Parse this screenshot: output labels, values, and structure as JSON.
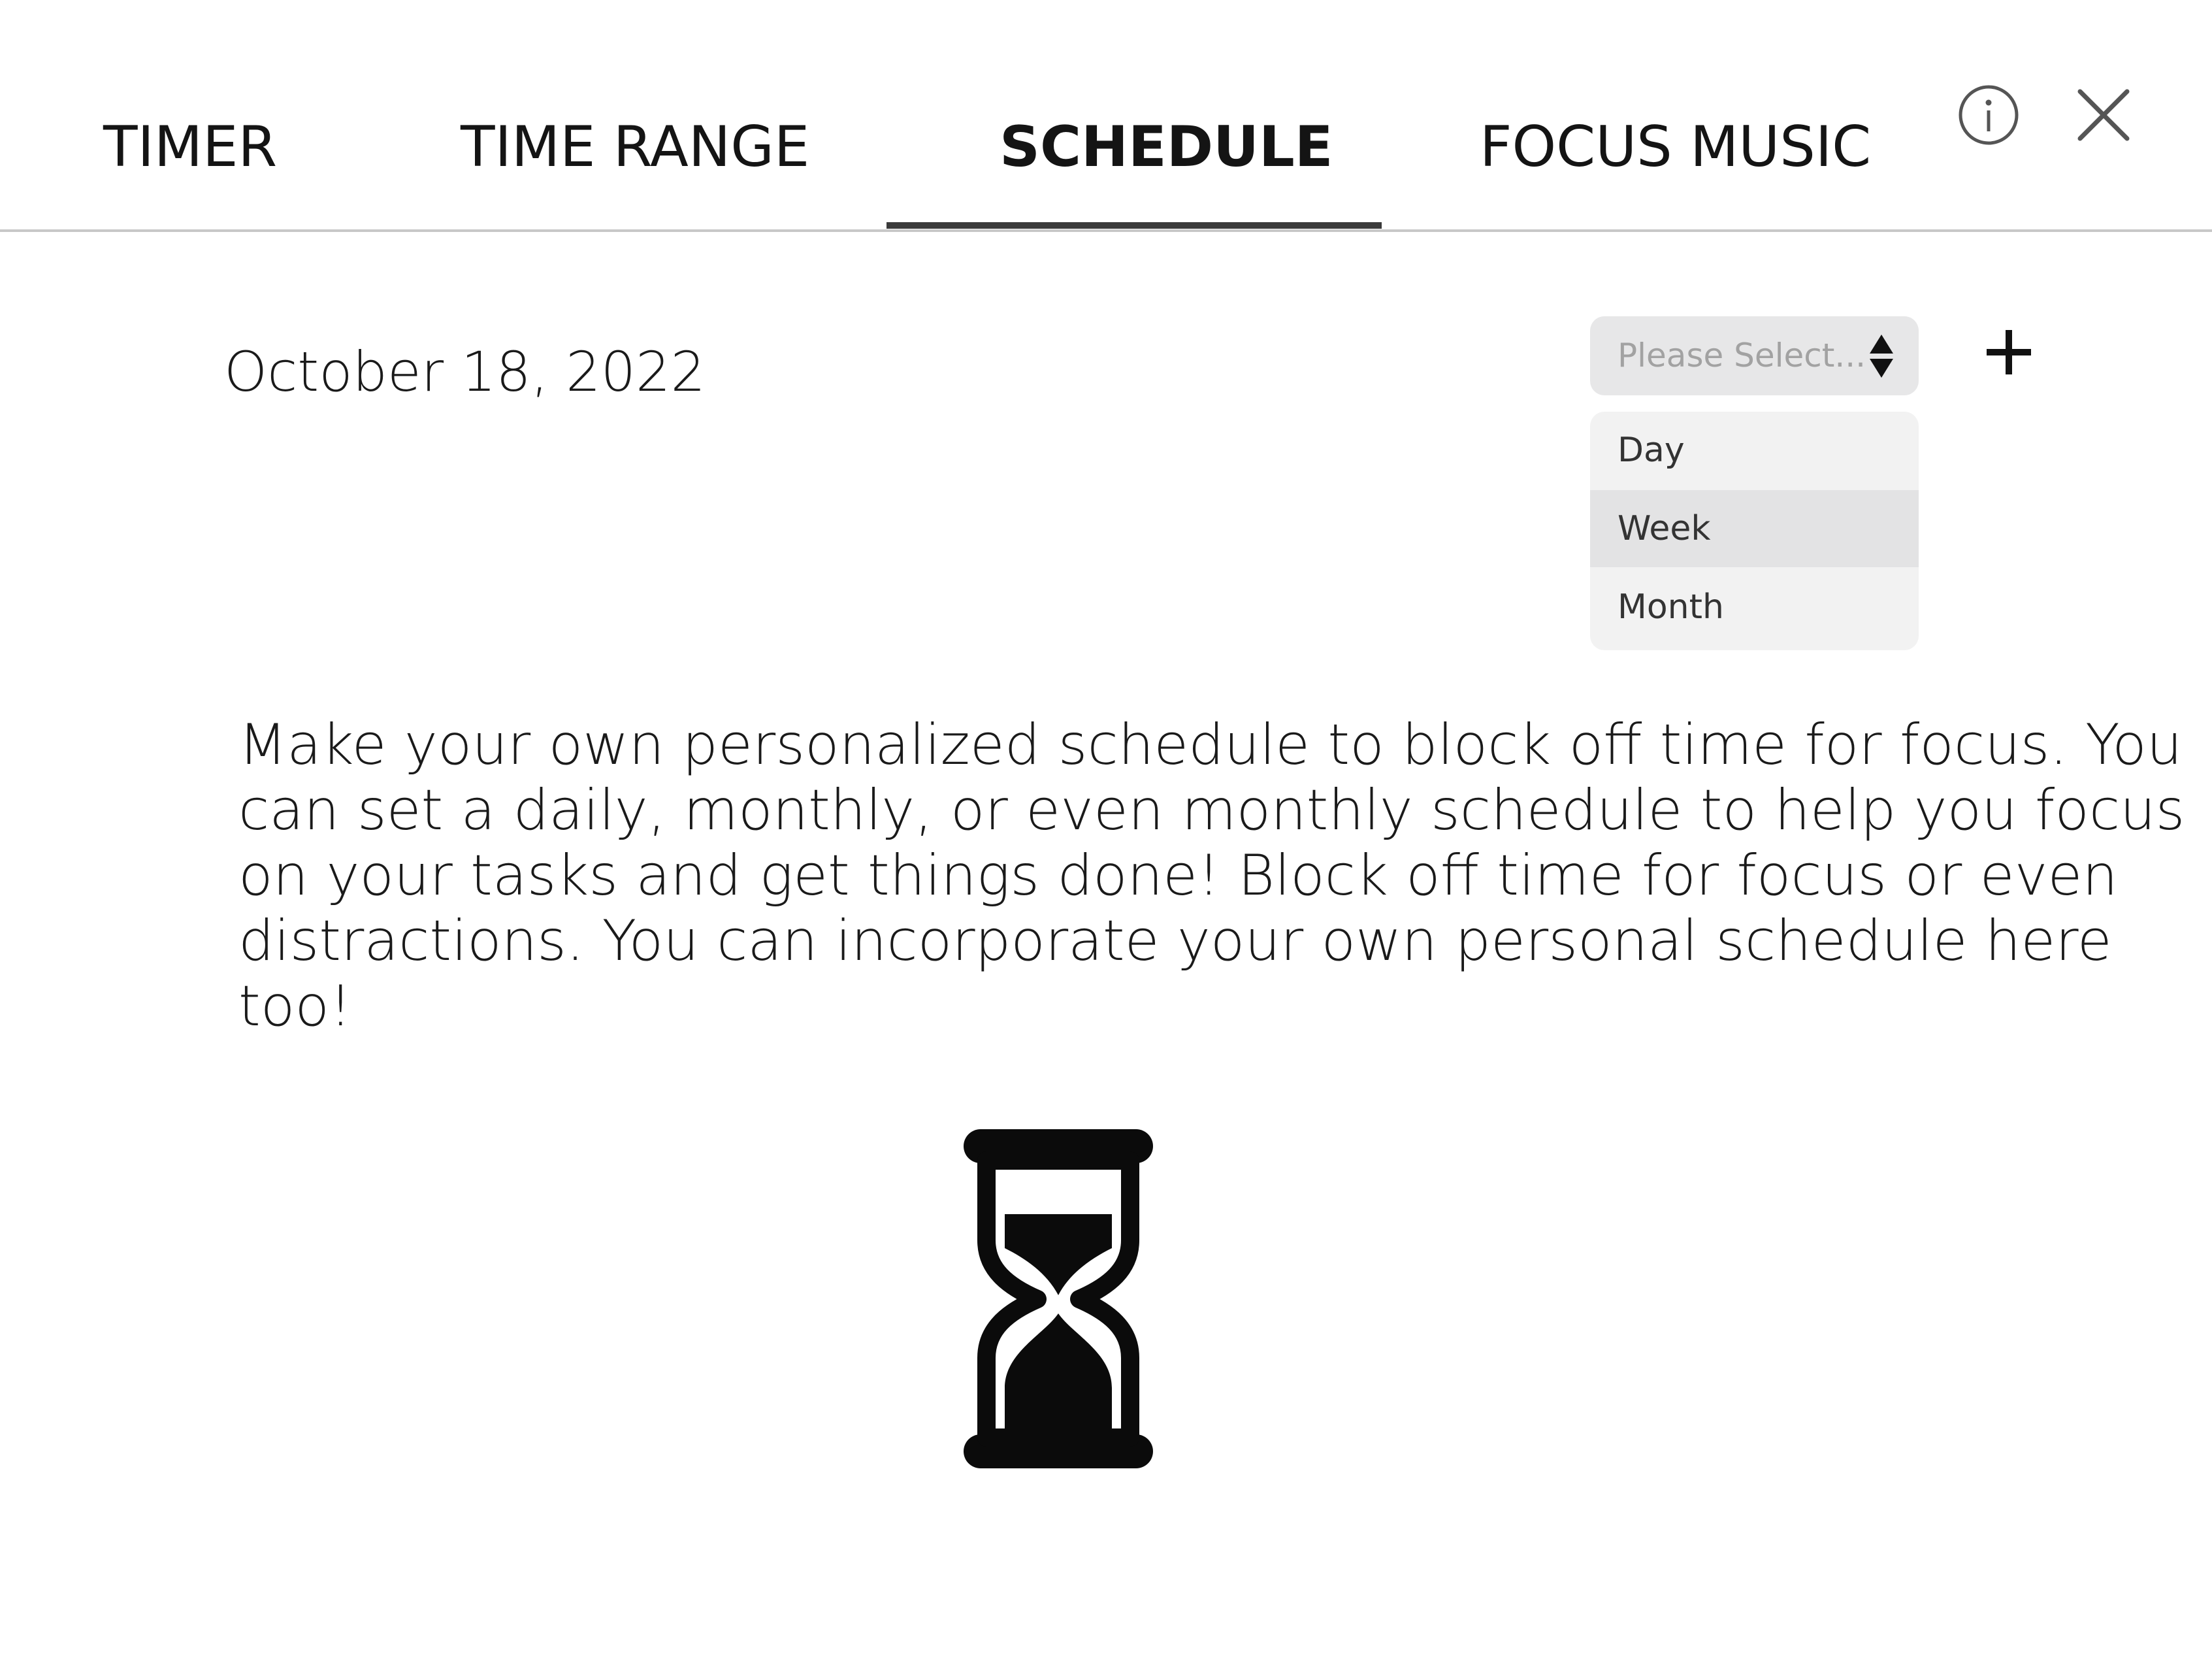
{
  "tabs": [
    {
      "label": "TIMER",
      "active": false
    },
    {
      "label": "TIME RANGE",
      "active": false
    },
    {
      "label": "SCHEDULE",
      "active": true
    },
    {
      "label": "FOCUS MUSIC",
      "active": false
    }
  ],
  "header_icons": {
    "info": "info-icon",
    "close": "close-icon"
  },
  "schedule": {
    "date": "October 18, 2022",
    "view_select": {
      "placeholder": "Please Select...",
      "options": [
        "Day",
        "Week",
        "Month"
      ],
      "highlighted_option": "Week"
    },
    "add_icon": "plus-icon",
    "description": "Make your own personalized schedule to block off time for focus. You can set a daily, monthly, or even monthly schedule to help you focus on your tasks and get things done! Block off time for focus or even distractions. You can incorporate your own personal schedule here too!",
    "illustration_icon": "hourglass-icon"
  },
  "colors": {
    "tab_underline": "#3a3a3a",
    "divider": "#c8c8c8",
    "select_bg": "#e7e7e8",
    "menu_bg": "#f2f2f2",
    "menu_hover": "#e3e3e4",
    "placeholder_text": "#a2a2a2"
  }
}
